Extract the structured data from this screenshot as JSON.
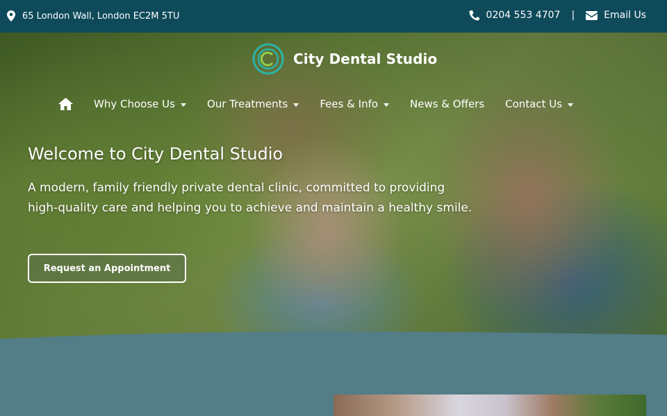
{
  "topbar": {
    "address": "65 London Wall, London EC2M 5TU",
    "phone": "0204 553 4707",
    "separator": "|",
    "email_label": "Email Us"
  },
  "brand": {
    "name": "City Dental Studio",
    "logo_ring_color": "#2bb3a6",
    "logo_accent_color": "#8fd14f"
  },
  "nav": {
    "items": [
      {
        "label": "Why Choose Us",
        "has_dropdown": true
      },
      {
        "label": "Our Treatments",
        "has_dropdown": true
      },
      {
        "label": "Fees & Info",
        "has_dropdown": true
      },
      {
        "label": "News & Offers",
        "has_dropdown": false
      },
      {
        "label": "Contact Us",
        "has_dropdown": true
      }
    ]
  },
  "hero": {
    "title": "Welcome to City Dental Studio",
    "lead_line1": "A modern, family friendly private dental clinic, committed to providing",
    "lead_line2": "high-quality care and helping you to achieve and maintain a healthy smile.",
    "cta_label": "Request an Appointment"
  },
  "colors": {
    "topbar_bg": "#0e4a5a",
    "section_bg": "#537d87"
  },
  "icons": {
    "address": "map-pin-icon",
    "phone": "phone-icon",
    "email": "envelope-icon",
    "home": "home-icon",
    "dropdown": "caret-down-icon"
  }
}
